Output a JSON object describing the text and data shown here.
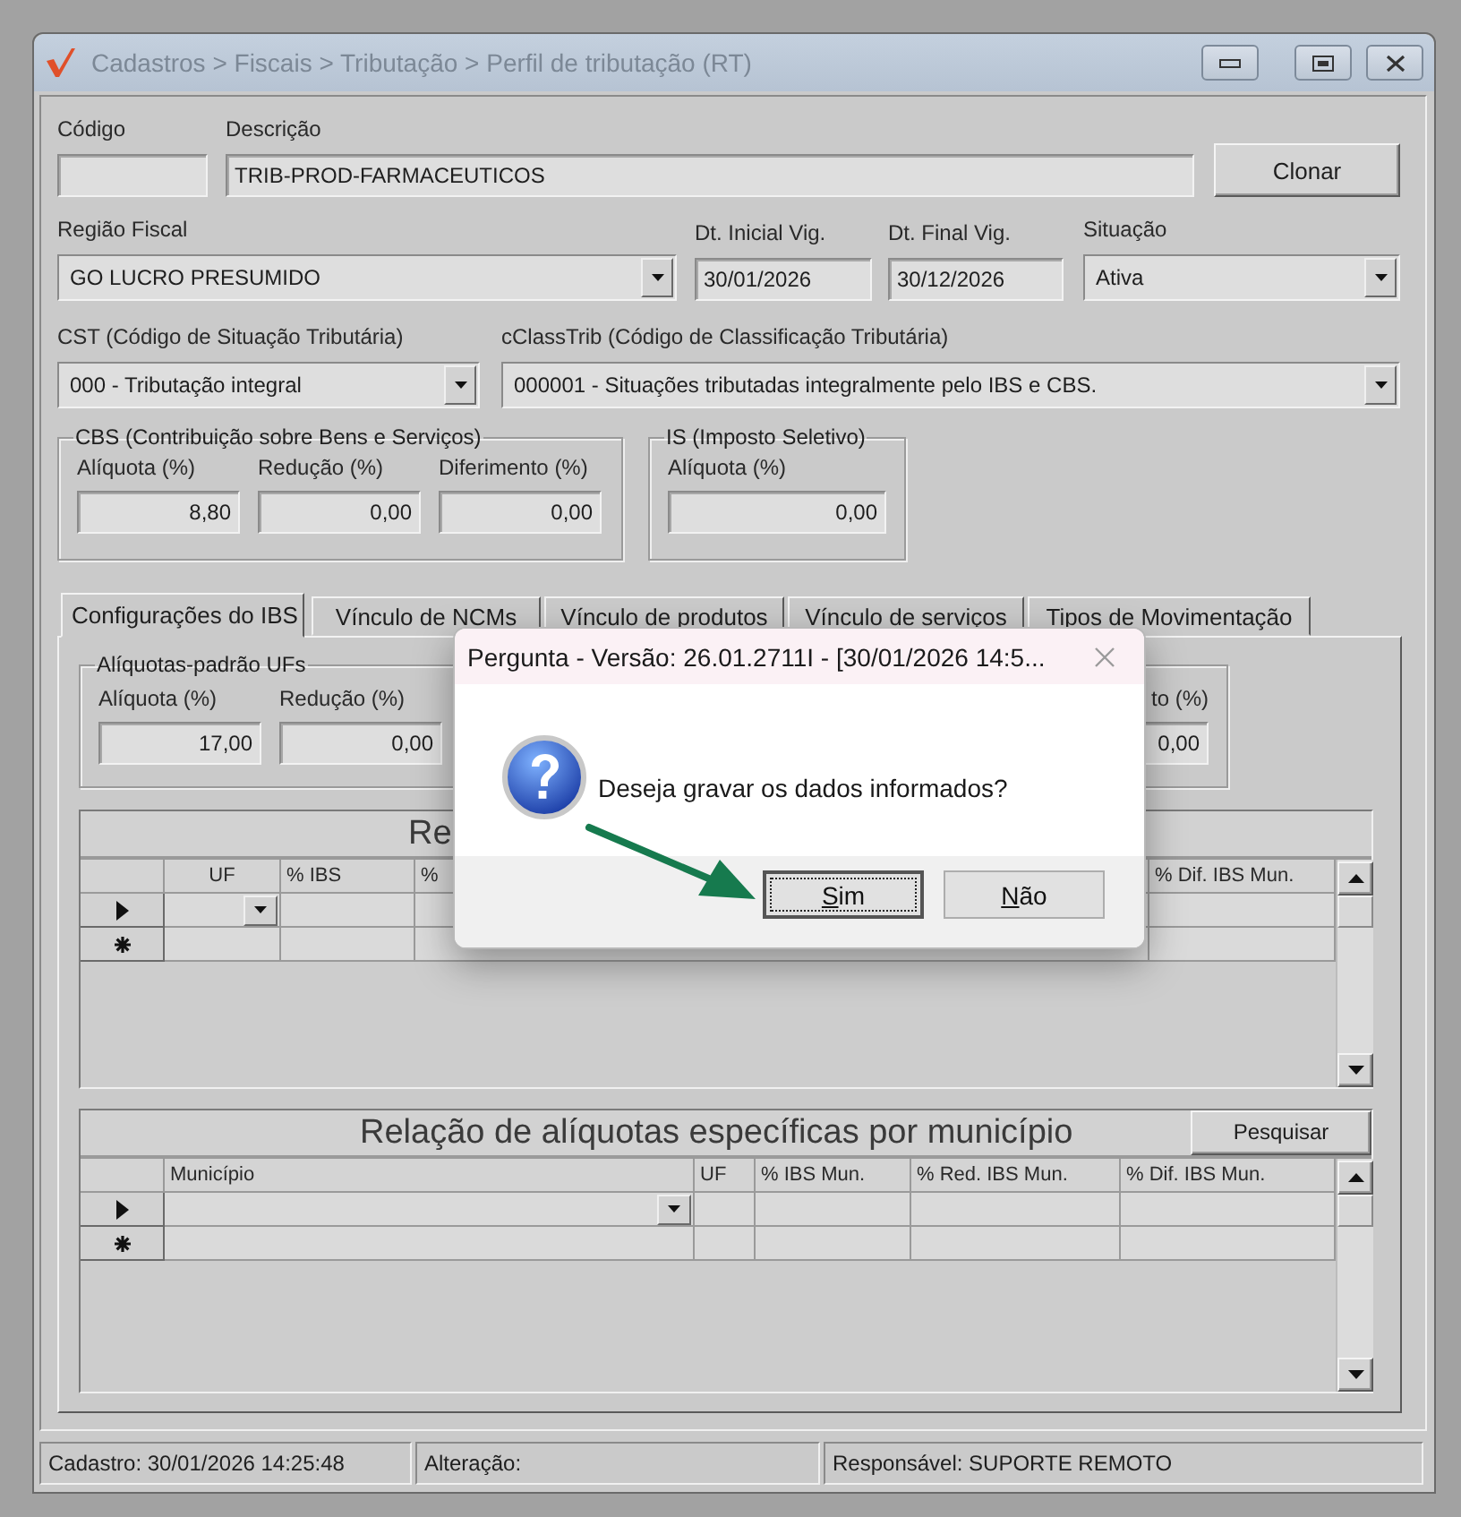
{
  "window": {
    "title": "Cadastros > Fiscais > Tributação > Perfil de tributação (RT)"
  },
  "form_rows": [
    [
      {
        "kind": "text",
        "label": "Código"
      },
      {
        "kind": "text",
        "label": "Descrição",
        "value": "TRIB-PROD-FARMACEUTICOS"
      },
      {
        "kind": "button",
        "label": "Clonar"
      }
    ],
    [
      {
        "kind": "combo",
        "label": "Região Fiscal",
        "value": "GO LUCRO PRESUMIDO"
      },
      {
        "kind": "text",
        "label": "Dt. Inicial Vig.",
        "value": "30/01/2026"
      },
      {
        "kind": "text",
        "label": "Dt. Final Vig.",
        "value": "30/12/2026"
      },
      {
        "kind": "combo",
        "label": "Situação",
        "value": "Ativa"
      }
    ],
    [
      {
        "kind": "combo",
        "label": "CST (Código de Situação Tributária)",
        "value": "000 - Tributação integral"
      },
      {
        "kind": "combo",
        "label": "cClassTrib (Código de Classificação Tributária)",
        "value": "000001 - Situações tributadas integralmente pelo IBS e CBS."
      }
    ]
  ],
  "groups": [
    {
      "title": "CBS (Contribuição sobre Bens e Serviços)",
      "fields": [
        {
          "label": "Alíquota (%)",
          "value": "8,80"
        },
        {
          "label": "Redução (%)",
          "value": "0,00"
        },
        {
          "label": "Diferimento (%)",
          "value": "0,00"
        }
      ]
    },
    {
      "title": "IS (Imposto Seletivo)",
      "fields": [
        {
          "label": "Alíquota (%)",
          "value": "0,00"
        }
      ]
    }
  ],
  "tabs": [
    {
      "label": "Configurações do IBS",
      "selected": true
    },
    {
      "label": "Vínculo de NCMs",
      "selected": false
    },
    {
      "label": "Vínculo de produtos",
      "selected": false
    },
    {
      "label": "Vínculo de serviços",
      "selected": false
    },
    {
      "label": "Tipos de Movimentação",
      "selected": false
    }
  ],
  "uf_rates": {
    "title": "Alíquotas-padrão UFs",
    "fields": [
      {
        "label": "Alíquota (%)",
        "value": "17,00"
      },
      {
        "label": "Redução (%)",
        "value": "0,00"
      }
    ],
    "right_field": {
      "label": "to (%)",
      "value": "0,00"
    }
  },
  "grids": [
    {
      "title": "Re",
      "columns": [
        {
          "label": "UF"
        },
        {
          "label": "% IBS"
        },
        {
          "label": "%"
        },
        {
          "label": "% Dif. IBS Mun."
        }
      ],
      "rows": [
        {
          "kind": "current"
        },
        {
          "kind": "new"
        }
      ]
    },
    {
      "title": "Relação de alíquotas específicas por município",
      "search_button": "Pesquisar",
      "columns": [
        {
          "label": "Município"
        },
        {
          "label": "UF"
        },
        {
          "label": "% IBS Mun."
        },
        {
          "label": "% Red. IBS Mun."
        },
        {
          "label": "% Dif. IBS Mun."
        }
      ],
      "rows": [
        {
          "kind": "current"
        },
        {
          "kind": "new"
        }
      ]
    }
  ],
  "status_bar": [
    "Cadastro: 30/01/2026 14:25:48",
    "Alteração:",
    "Responsável: SUPORTE REMOTO"
  ],
  "dialog": {
    "title": "Pergunta - Versão: 26.01.2711I - [30/01/2026 14:5...",
    "message": "Deseja gravar os dados informados?",
    "buttons": [
      {
        "label": "Sim",
        "focused": true
      },
      {
        "label": "Não",
        "focused": false
      }
    ]
  }
}
